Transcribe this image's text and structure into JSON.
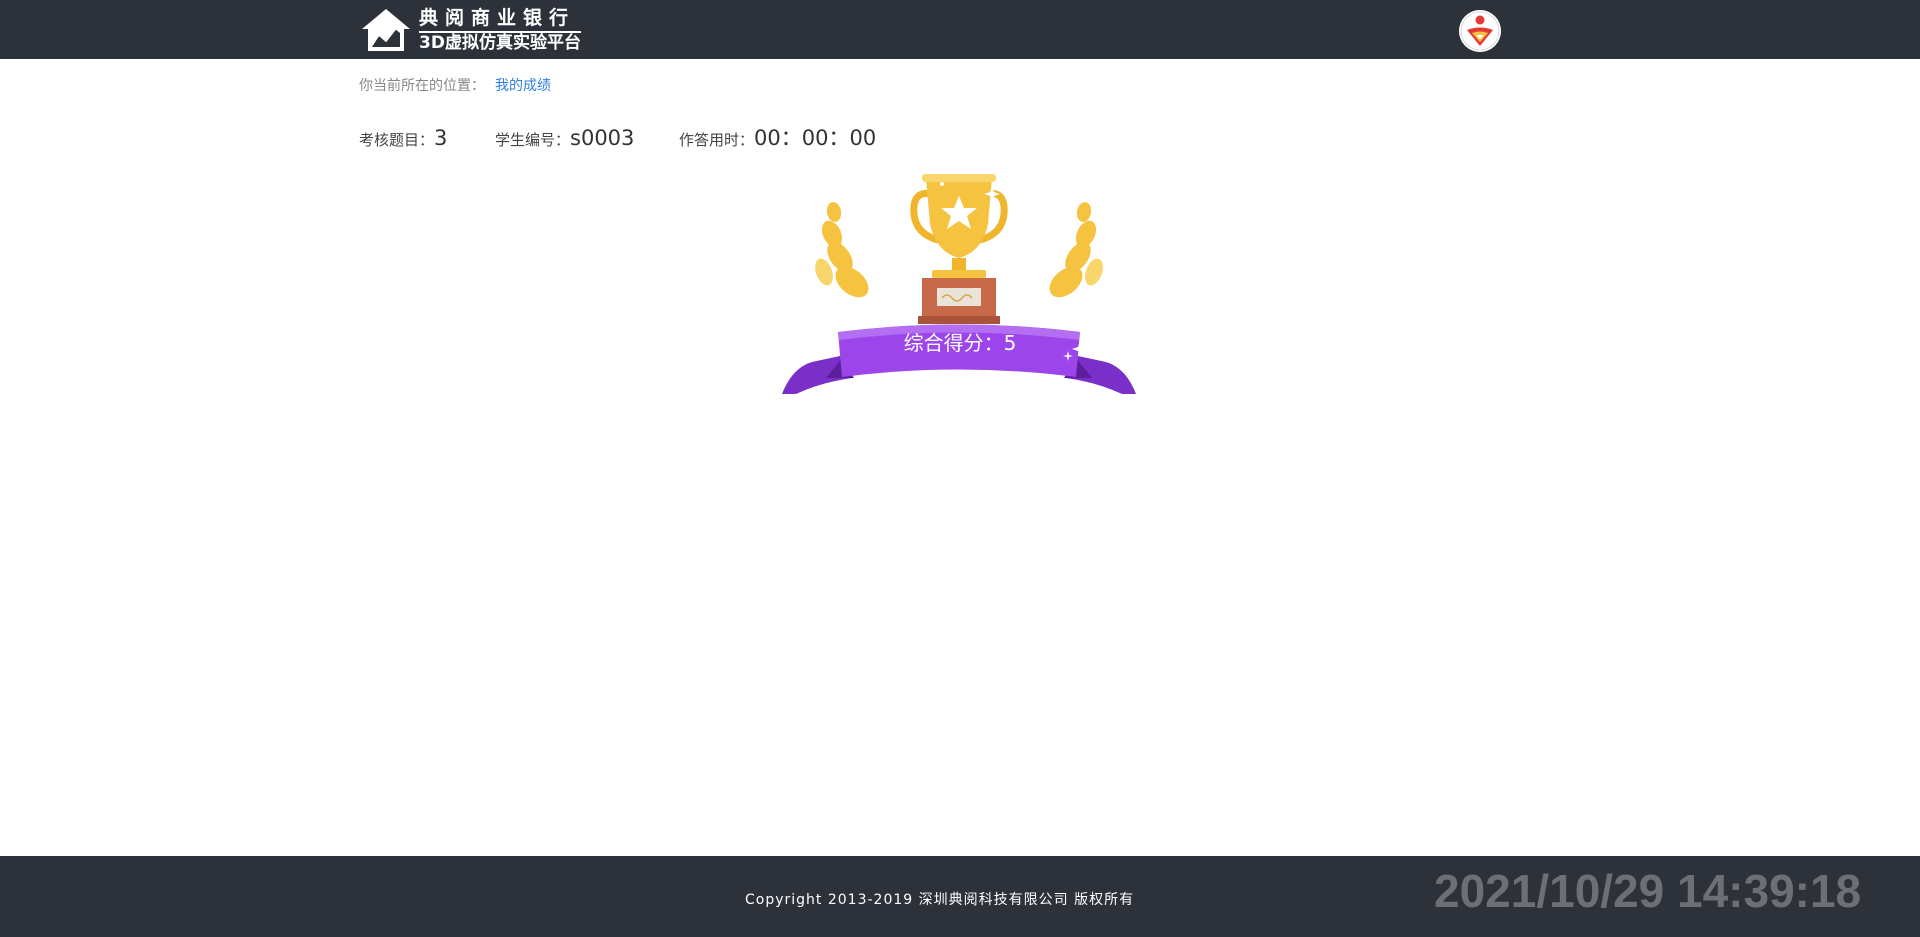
{
  "header": {
    "logo_line1": "典阅商业银行",
    "logo_line2": "3D虚拟仿真实验平台",
    "logo_icon": "house-chart-icon",
    "avatar_icon": "user-avatar-icon"
  },
  "breadcrumb": {
    "prefix": "你当前所在的位置：",
    "current": "我的成绩"
  },
  "info": {
    "exam_label": "考核题目：",
    "exam_value": "3",
    "student_label": "学生编号：",
    "student_value": "s0003",
    "time_label": "作答用时：",
    "time_value": "00：00：00"
  },
  "result": {
    "score_text": "综合得分：5",
    "trophy_icon": "trophy-icon"
  },
  "footer": {
    "copyright": "Copyright 2013-2019 深圳典阅科技有限公司 版权所有",
    "clock": "2021/10/29 14:39:18"
  },
  "colors": {
    "header_bg": "#2c313a",
    "link": "#2f7fe0",
    "ribbon": "#9b45ea",
    "gold": "#f6c340"
  }
}
